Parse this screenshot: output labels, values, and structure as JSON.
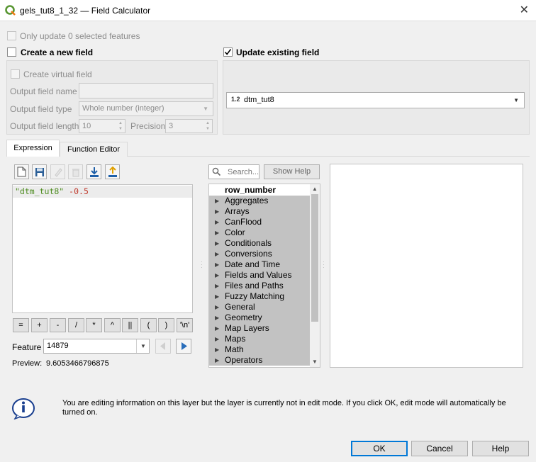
{
  "window": {
    "title": "gels_tut8_1_32 — Field Calculator",
    "close": "✕"
  },
  "only_update": "Only update 0 selected features",
  "create_new_field": "Create a new field",
  "update_existing_field": "Update existing field",
  "create_virtual_field": "Create virtual field",
  "output_field_name_label": "Output field name",
  "output_field_type_label": "Output field type",
  "output_field_type_value": "Whole number (integer)",
  "output_field_length_label": "Output field length",
  "output_field_length_value": "10",
  "precision_label": "Precision",
  "precision_value": "3",
  "field_select": {
    "type_badge": "1.2",
    "value": "dtm_tut8"
  },
  "tabs": [
    {
      "label": "Expression"
    },
    {
      "label": "Function Editor"
    }
  ],
  "expression": {
    "field": "\"dtm_tut8\"",
    "op": " -0.5"
  },
  "operators": [
    "=",
    "+",
    "-",
    "/",
    "*",
    "^",
    "||",
    "(",
    ")",
    "'\\n'"
  ],
  "feature_label": "Feature",
  "feature_value": "14879",
  "preview_label": "Preview:",
  "preview_value": "9.6053466796875",
  "search_placeholder": "Search...",
  "show_help": "Show Help",
  "function_tree": [
    "row_number",
    "Aggregates",
    "Arrays",
    "CanFlood",
    "Color",
    "Conditionals",
    "Conversions",
    "Date and Time",
    "Fields and Values",
    "Files and Paths",
    "Fuzzy Matching",
    "General",
    "Geometry",
    "Map Layers",
    "Maps",
    "Math",
    "Operators"
  ],
  "info_message": "You are editing information on this layer but the layer is currently not in edit mode. If you click OK, edit mode will automatically be turned on.",
  "buttons": {
    "ok": "OK",
    "cancel": "Cancel",
    "help": "Help"
  }
}
